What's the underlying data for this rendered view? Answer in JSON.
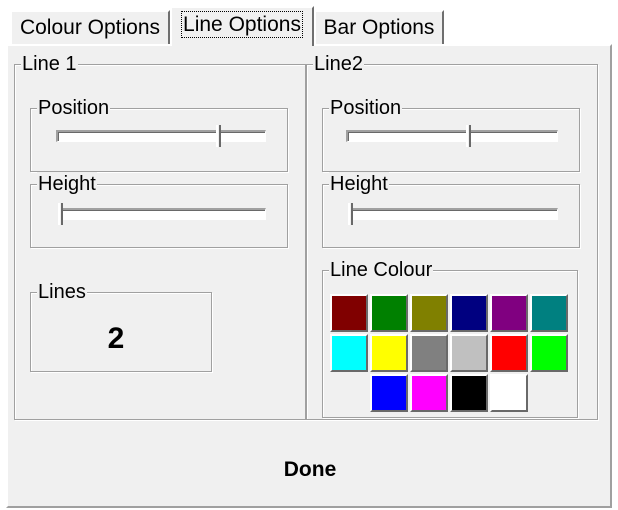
{
  "tabs": [
    {
      "label": "Colour Options",
      "active": false
    },
    {
      "label": "Line Options",
      "active": true
    },
    {
      "label": "Bar Options",
      "active": false
    }
  ],
  "line1": {
    "title": "Line 1",
    "position_label": "Position",
    "height_label": "Height",
    "lines_label": "Lines",
    "lines_value": "2",
    "position_level": 0.78,
    "height_level": 0.0
  },
  "line2": {
    "title": "Line2",
    "position_label": "Position",
    "height_label": "Height",
    "position_level": 0.58,
    "height_level": 0.0,
    "colour_label": "Line Colour",
    "colours": [
      "#800000",
      "#008000",
      "#808000",
      "#000080",
      "#800080",
      "#008080",
      "#00ffff",
      "#ffff00",
      "#808080",
      "#c0c0c0",
      "#ff0000",
      "#00ff00",
      "#0000ff",
      "#ff00ff",
      "#000000",
      "#ffffff"
    ]
  },
  "footer": {
    "done_label": "Done"
  }
}
